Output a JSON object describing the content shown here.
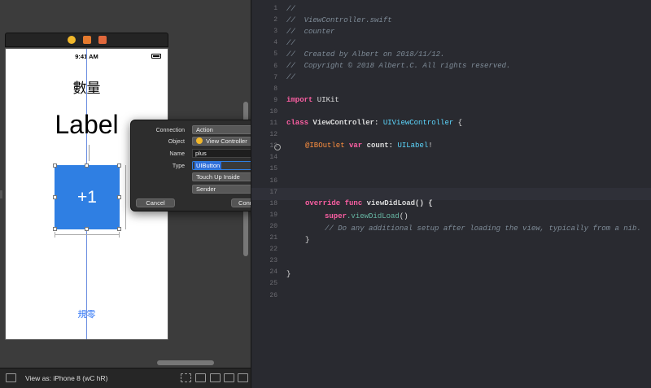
{
  "canvas": {
    "status_time": "9:41 AM",
    "title_label": "數量",
    "count_label": "Label",
    "plus_button_label": "+1",
    "reset_label": "規零"
  },
  "popover": {
    "connection_label": "Connection",
    "connection_value": "Action",
    "object_label": "Object",
    "object_value": "View Controller",
    "name_label": "Name",
    "name_value": "plus",
    "type_label": "Type",
    "type_value": "UIButton",
    "event_value": "Touch Up Inside",
    "arguments_value": "Sender",
    "cancel_label": "Cancel",
    "connect_label": "Connect"
  },
  "editor": {
    "line_numbers": [
      "1",
      "2",
      "3",
      "4",
      "5",
      "6",
      "7",
      "8",
      "9",
      "10",
      "11",
      "12",
      "13",
      "14",
      "15",
      "16",
      "17",
      "18",
      "19",
      "20",
      "21",
      "22",
      "23",
      "24",
      "25",
      "26"
    ],
    "comment_1": "//",
    "comment_2": "//  ViewController.swift",
    "comment_3": "//  counter",
    "comment_4": "//",
    "comment_5": "//  Created by Albert on 2018/11/12.",
    "comment_6": "//  Copyright © 2018 Albert.C. All rights reserved.",
    "comment_7": "//",
    "import_kw": "import",
    "import_mod": " UIKit",
    "class_kw": "class",
    "class_name": " ViewController: ",
    "class_super": "UIViewController",
    "class_brace": " {",
    "outlet_attr": "@IBOutlet",
    "outlet_var": " var",
    "outlet_name": " count: ",
    "outlet_type": "UILabel",
    "outlet_bang": "!",
    "override_kw": "override",
    "func_kw": " func",
    "func_sig": " viewDidLoad() {",
    "super_kw": "super",
    "super_call": ".viewDidLoad",
    "super_paren": "()",
    "setup_comment": "// Do any additional setup after loading the view, typically from a nib.",
    "close_brace_inner": "}",
    "close_brace_outer": "}"
  },
  "bottombar": {
    "view_as": "View as: iPhone 8 (wC hR)"
  },
  "colors": {
    "accent": "#2f7fe3",
    "keyword": "#fc5fa3",
    "type": "#5dd8ff",
    "attribute": "#fd8f3f",
    "comment": "#7f8c98"
  }
}
